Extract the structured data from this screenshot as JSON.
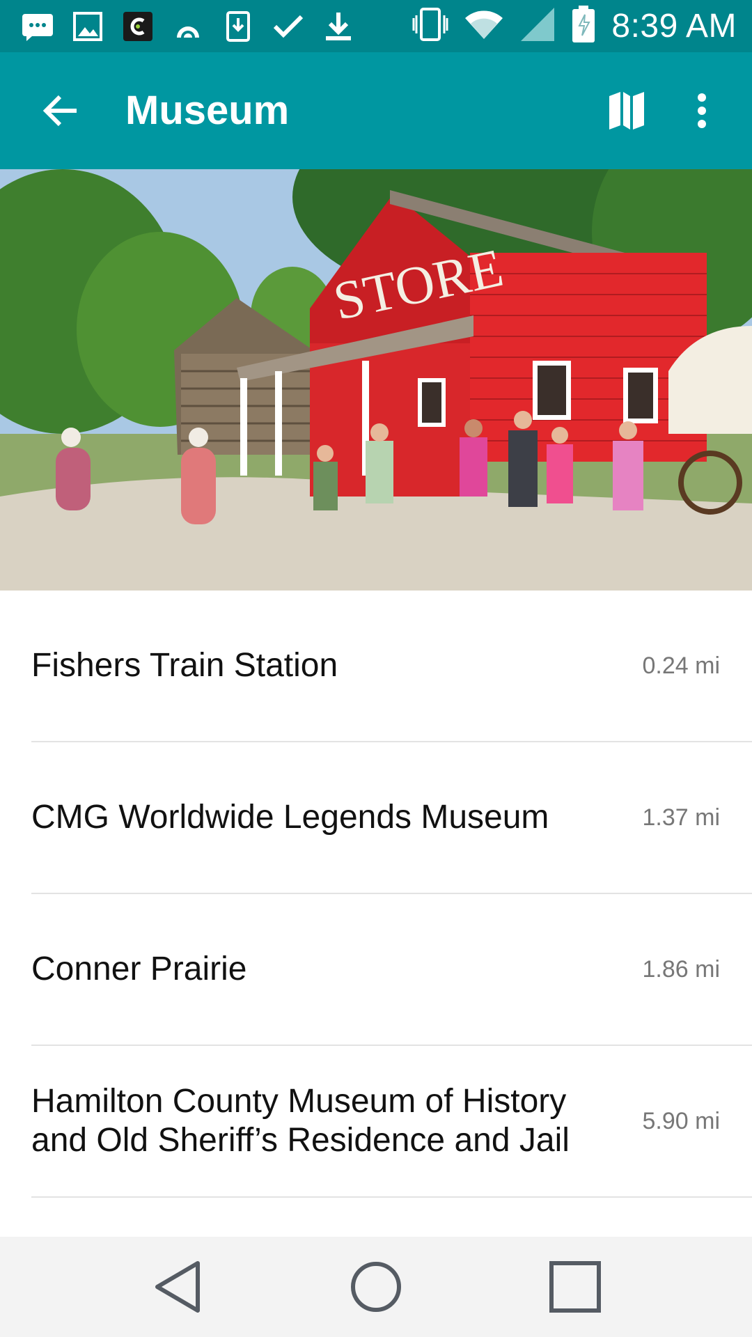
{
  "status_bar": {
    "time": "8:39 AM",
    "icons_left": [
      "message-icon",
      "image-icon",
      "app-icon",
      "signal-arc-icon",
      "download-box-icon",
      "check-icon",
      "download-icon"
    ],
    "icons_right": [
      "vibrate-icon",
      "wifi-icon",
      "cell-signal-icon",
      "battery-charging-icon"
    ]
  },
  "app_bar": {
    "title": "Museum",
    "actions": [
      "back-arrow-icon",
      "map-icon",
      "more-vert-icon"
    ]
  },
  "hero": {
    "sign_text": "STORE"
  },
  "places": [
    {
      "name": "Fishers Train Station",
      "distance": "0.24 mi"
    },
    {
      "name": "CMG Worldwide Legends Museum",
      "distance": "1.37 mi"
    },
    {
      "name": "Conner Prairie",
      "distance": "1.86 mi"
    },
    {
      "name": "Hamilton County Museum of History and Old Sheriff’s Residence and Jail",
      "distance": "5.90 mi"
    }
  ],
  "colors": {
    "status_bar": "#00858c",
    "app_bar": "#0097a1",
    "nav_bar": "#f3f3f3",
    "store_red": "#e2282c"
  }
}
